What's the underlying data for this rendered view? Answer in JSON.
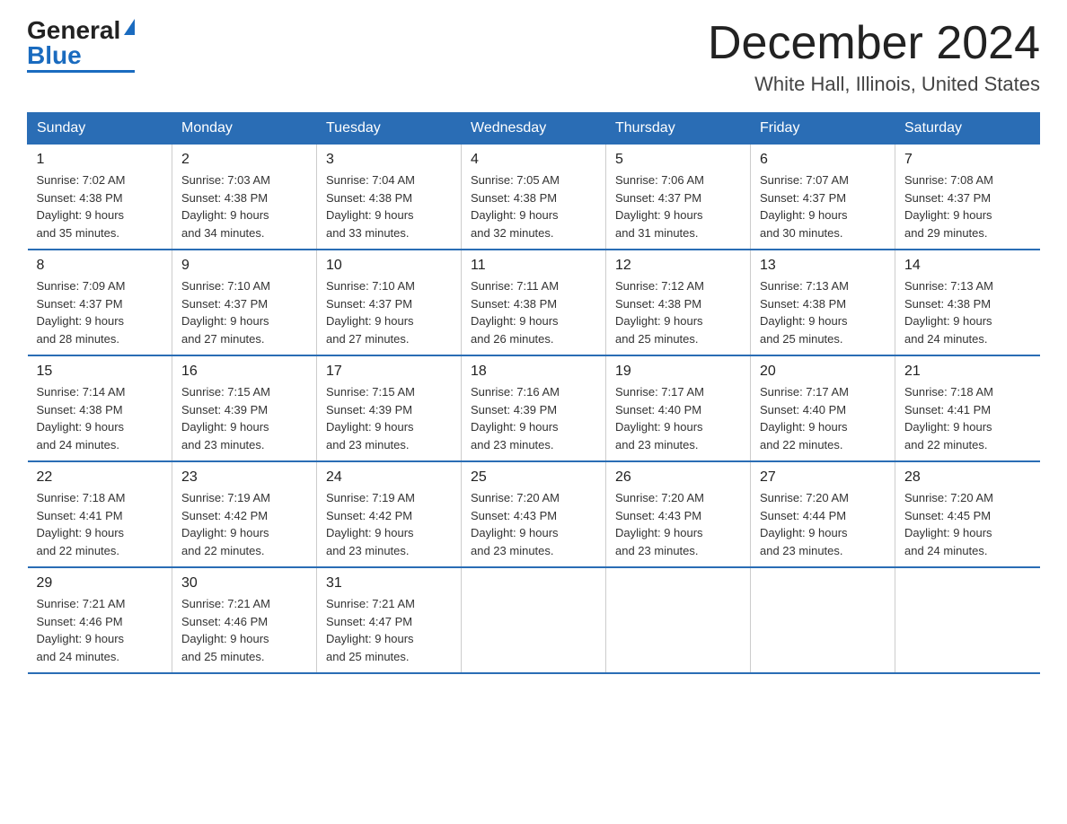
{
  "logo": {
    "general": "General",
    "blue": "Blue"
  },
  "title": "December 2024",
  "location": "White Hall, Illinois, United States",
  "days_of_week": [
    "Sunday",
    "Monday",
    "Tuesday",
    "Wednesday",
    "Thursday",
    "Friday",
    "Saturday"
  ],
  "weeks": [
    [
      {
        "day": "1",
        "sunrise": "7:02 AM",
        "sunset": "4:38 PM",
        "daylight": "9 hours and 35 minutes."
      },
      {
        "day": "2",
        "sunrise": "7:03 AM",
        "sunset": "4:38 PM",
        "daylight": "9 hours and 34 minutes."
      },
      {
        "day": "3",
        "sunrise": "7:04 AM",
        "sunset": "4:38 PM",
        "daylight": "9 hours and 33 minutes."
      },
      {
        "day": "4",
        "sunrise": "7:05 AM",
        "sunset": "4:38 PM",
        "daylight": "9 hours and 32 minutes."
      },
      {
        "day": "5",
        "sunrise": "7:06 AM",
        "sunset": "4:37 PM",
        "daylight": "9 hours and 31 minutes."
      },
      {
        "day": "6",
        "sunrise": "7:07 AM",
        "sunset": "4:37 PM",
        "daylight": "9 hours and 30 minutes."
      },
      {
        "day": "7",
        "sunrise": "7:08 AM",
        "sunset": "4:37 PM",
        "daylight": "9 hours and 29 minutes."
      }
    ],
    [
      {
        "day": "8",
        "sunrise": "7:09 AM",
        "sunset": "4:37 PM",
        "daylight": "9 hours and 28 minutes."
      },
      {
        "day": "9",
        "sunrise": "7:10 AM",
        "sunset": "4:37 PM",
        "daylight": "9 hours and 27 minutes."
      },
      {
        "day": "10",
        "sunrise": "7:10 AM",
        "sunset": "4:37 PM",
        "daylight": "9 hours and 27 minutes."
      },
      {
        "day": "11",
        "sunrise": "7:11 AM",
        "sunset": "4:38 PM",
        "daylight": "9 hours and 26 minutes."
      },
      {
        "day": "12",
        "sunrise": "7:12 AM",
        "sunset": "4:38 PM",
        "daylight": "9 hours and 25 minutes."
      },
      {
        "day": "13",
        "sunrise": "7:13 AM",
        "sunset": "4:38 PM",
        "daylight": "9 hours and 25 minutes."
      },
      {
        "day": "14",
        "sunrise": "7:13 AM",
        "sunset": "4:38 PM",
        "daylight": "9 hours and 24 minutes."
      }
    ],
    [
      {
        "day": "15",
        "sunrise": "7:14 AM",
        "sunset": "4:38 PM",
        "daylight": "9 hours and 24 minutes."
      },
      {
        "day": "16",
        "sunrise": "7:15 AM",
        "sunset": "4:39 PM",
        "daylight": "9 hours and 23 minutes."
      },
      {
        "day": "17",
        "sunrise": "7:15 AM",
        "sunset": "4:39 PM",
        "daylight": "9 hours and 23 minutes."
      },
      {
        "day": "18",
        "sunrise": "7:16 AM",
        "sunset": "4:39 PM",
        "daylight": "9 hours and 23 minutes."
      },
      {
        "day": "19",
        "sunrise": "7:17 AM",
        "sunset": "4:40 PM",
        "daylight": "9 hours and 23 minutes."
      },
      {
        "day": "20",
        "sunrise": "7:17 AM",
        "sunset": "4:40 PM",
        "daylight": "9 hours and 22 minutes."
      },
      {
        "day": "21",
        "sunrise": "7:18 AM",
        "sunset": "4:41 PM",
        "daylight": "9 hours and 22 minutes."
      }
    ],
    [
      {
        "day": "22",
        "sunrise": "7:18 AM",
        "sunset": "4:41 PM",
        "daylight": "9 hours and 22 minutes."
      },
      {
        "day": "23",
        "sunrise": "7:19 AM",
        "sunset": "4:42 PM",
        "daylight": "9 hours and 22 minutes."
      },
      {
        "day": "24",
        "sunrise": "7:19 AM",
        "sunset": "4:42 PM",
        "daylight": "9 hours and 23 minutes."
      },
      {
        "day": "25",
        "sunrise": "7:20 AM",
        "sunset": "4:43 PM",
        "daylight": "9 hours and 23 minutes."
      },
      {
        "day": "26",
        "sunrise": "7:20 AM",
        "sunset": "4:43 PM",
        "daylight": "9 hours and 23 minutes."
      },
      {
        "day": "27",
        "sunrise": "7:20 AM",
        "sunset": "4:44 PM",
        "daylight": "9 hours and 23 minutes."
      },
      {
        "day": "28",
        "sunrise": "7:20 AM",
        "sunset": "4:45 PM",
        "daylight": "9 hours and 24 minutes."
      }
    ],
    [
      {
        "day": "29",
        "sunrise": "7:21 AM",
        "sunset": "4:46 PM",
        "daylight": "9 hours and 24 minutes."
      },
      {
        "day": "30",
        "sunrise": "7:21 AM",
        "sunset": "4:46 PM",
        "daylight": "9 hours and 25 minutes."
      },
      {
        "day": "31",
        "sunrise": "7:21 AM",
        "sunset": "4:47 PM",
        "daylight": "9 hours and 25 minutes."
      },
      null,
      null,
      null,
      null
    ]
  ],
  "labels": {
    "sunrise": "Sunrise:",
    "sunset": "Sunset:",
    "daylight": "Daylight:"
  }
}
